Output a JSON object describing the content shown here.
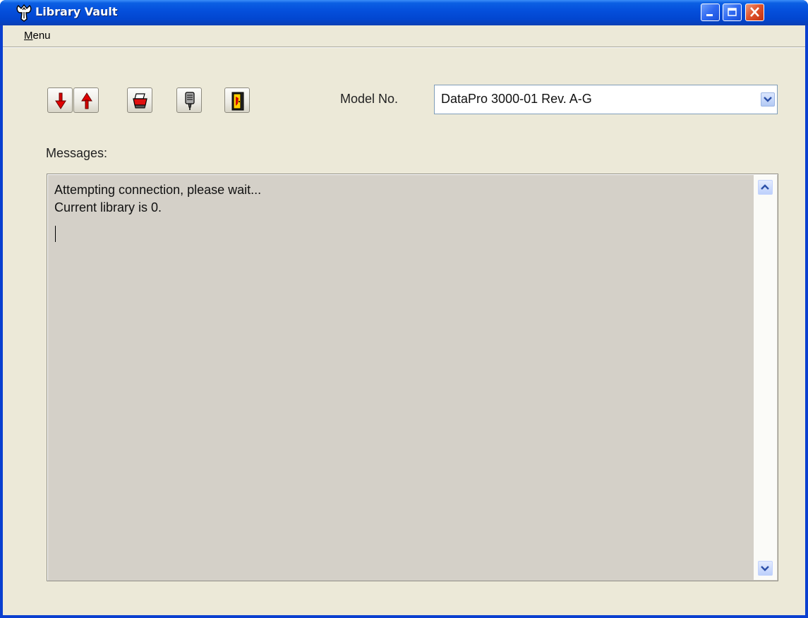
{
  "window": {
    "title": "Library Vault",
    "accent": "#0a3fd0"
  },
  "menu": {
    "items": [
      {
        "access_key": "M",
        "rest": "enu"
      }
    ]
  },
  "toolbar": {
    "buttons": [
      {
        "name": "download-button",
        "icon": "red-down-arrow-icon"
      },
      {
        "name": "upload-button",
        "icon": "red-up-arrow-icon"
      },
      {
        "name": "print-button",
        "icon": "printer-icon"
      },
      {
        "name": "connect-button",
        "icon": "serial-plug-icon"
      },
      {
        "name": "exit-button",
        "icon": "exit-door-icon"
      }
    ]
  },
  "model": {
    "label": "Model No.",
    "value": "DataPro 3000-01 Rev. A-G"
  },
  "messages": {
    "label": "Messages:",
    "lines": [
      "Attempting connection, please wait...",
      "Current library is 0."
    ]
  }
}
